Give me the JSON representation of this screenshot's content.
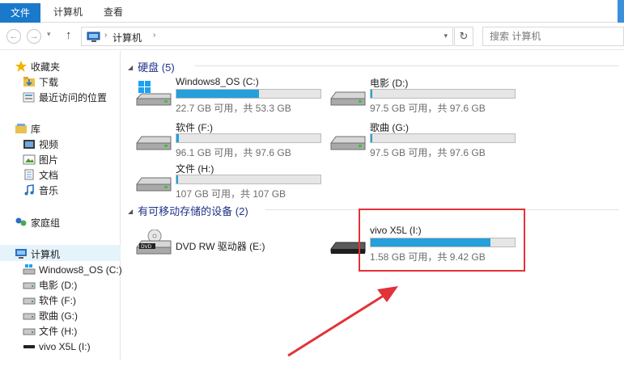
{
  "ribbon": {
    "tabs": [
      "文件",
      "计算机",
      "查看"
    ]
  },
  "address": {
    "crumb": "计算机",
    "sep": "›",
    "search_placeholder": "搜索 计算机"
  },
  "sidebar": {
    "favorites": {
      "label": "收藏夹",
      "items": [
        "下载",
        "最近访问的位置"
      ]
    },
    "libraries": {
      "label": "库",
      "items": [
        "视频",
        "图片",
        "文档",
        "音乐"
      ]
    },
    "homegroup": "家庭组",
    "computer": {
      "label": "计算机",
      "items": [
        "Windows8_OS (C:)",
        "电影 (D:)",
        "软件 (F:)",
        "歌曲 (G:)",
        "文件 (H:)",
        "vivo X5L (I:)"
      ]
    }
  },
  "groups": {
    "hard_drives": "硬盘 (5)",
    "removable": "有可移动存储的设备 (2)"
  },
  "drives": [
    {
      "name": "Windows8_OS (C:)",
      "info": "22.7 GB 可用，共 53.3 GB",
      "used_fraction": 0.574
    },
    {
      "name": "电影 (D:)",
      "info": "97.5 GB 可用，共 97.6 GB",
      "used_fraction": 0.01
    },
    {
      "name": "软件 (F:)",
      "info": "96.1 GB 可用，共 97.6 GB",
      "used_fraction": 0.015
    },
    {
      "name": "歌曲 (G:)",
      "info": "97.5 GB 可用，共 97.6 GB",
      "used_fraction": 0.01
    },
    {
      "name": "文件 (H:)",
      "info": "107 GB 可用，共 107 GB",
      "used_fraction": 0.0
    }
  ],
  "removable": [
    {
      "name": "DVD RW 驱动器 (E:)"
    },
    {
      "name": "vivo X5L (I:)",
      "info": "1.58 GB 可用，共 9.42 GB",
      "used_fraction": 0.832
    }
  ],
  "colors": {
    "accent": "#1979ca",
    "bar_fill": "#26a0da",
    "highlight": "#e2323a",
    "group_head": "#1e3287"
  }
}
